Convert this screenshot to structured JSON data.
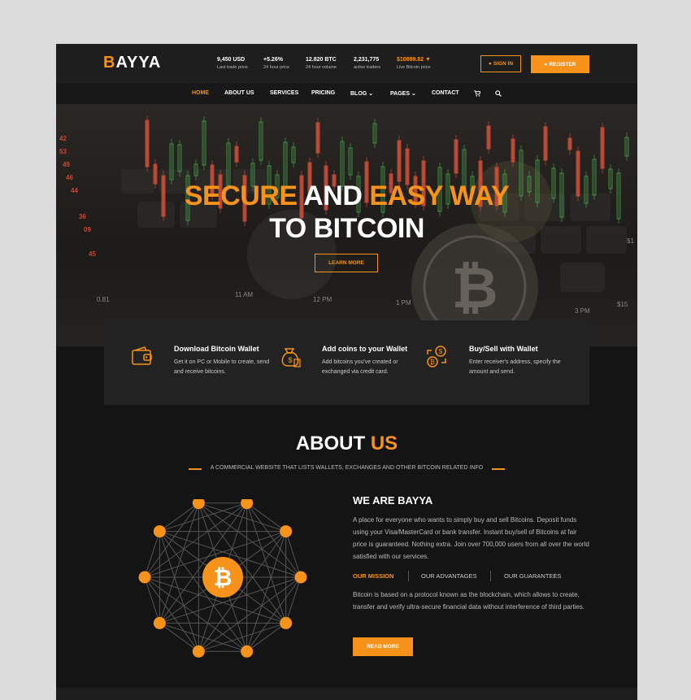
{
  "brand": {
    "logo_b": "B",
    "logo_rest": "AYYA"
  },
  "stats": [
    {
      "value": "9,450 USD",
      "label": "Last trade price"
    },
    {
      "value": "+5.26%",
      "label": "24 hour price"
    },
    {
      "value": "12.820 BTC",
      "label": "24 hour volume"
    },
    {
      "value": "2,231,775",
      "label": "active traders"
    },
    {
      "value": "$10889.82 ▼",
      "label": "Live Bitcoin price"
    }
  ],
  "auth": {
    "signin": "SIGN IN",
    "register": "REGISTER"
  },
  "nav": {
    "home": "HOME",
    "about": "ABOUT US",
    "services": "SERVICES",
    "pricing": "PRICING",
    "blog": "BLOG",
    "pages": "PAGES",
    "contact": "CONTACT"
  },
  "hero": {
    "line1_a": "SECURE",
    "line1_b": "AND",
    "line1_c": "EASY WAY",
    "line2": "TO BITCOIN",
    "button": "LEARN MORE",
    "tickers": [
      "42",
      "53",
      "49",
      "46",
      "44",
      "36",
      "09",
      "45",
      "0.81"
    ],
    "time_labels": [
      "11 AM",
      "12 PM",
      "1 PM",
      "3 PM",
      "$15",
      "$1"
    ]
  },
  "features": [
    {
      "title": "Download Bitcoin Wallet",
      "desc": "Get it on PC or Mobile to create, send and receive bitcoins.",
      "icon": "wallet-icon"
    },
    {
      "title": "Add coins to your Wallet",
      "desc": "Add bitcoins you've created or exchanged via credit card.",
      "icon": "money-bag-icon"
    },
    {
      "title": "Buy/Sell with Wallet",
      "desc": "Enter receiver's address, specify the amount and send.",
      "icon": "exchange-icon"
    }
  ],
  "about": {
    "title_a": "ABOUT",
    "title_b": "US",
    "subtitle": "A COMMERCIAL WEBSITE THAT LISTS WALLETS, EXCHANGES AND OTHER BITCOIN RELATED INFO",
    "heading": "WE ARE BAYYA",
    "para1": "A place for everyone who wants to simply buy and sell Bitcoins. Deposit funds using your Visa/MasterCard or bank transfer. Instant buy/sell of Bitcoins at fair price is guaranteed. Nothing extra. Join over 700,000 users from all over the world satisfied with our services.",
    "tabs": [
      "OUR MISSION",
      "OUR ADVANTAGES",
      "OUR GUARANTEES"
    ],
    "para2": "Bitcoin is based on a protocol known as the blockchain, which allows to create, transfer and verify ultra-secure financial data without interference of third parties.",
    "button": "READ MORE",
    "center_symbol": "₿"
  },
  "colors": {
    "accent": "#f7931a",
    "bg": "#141414"
  }
}
